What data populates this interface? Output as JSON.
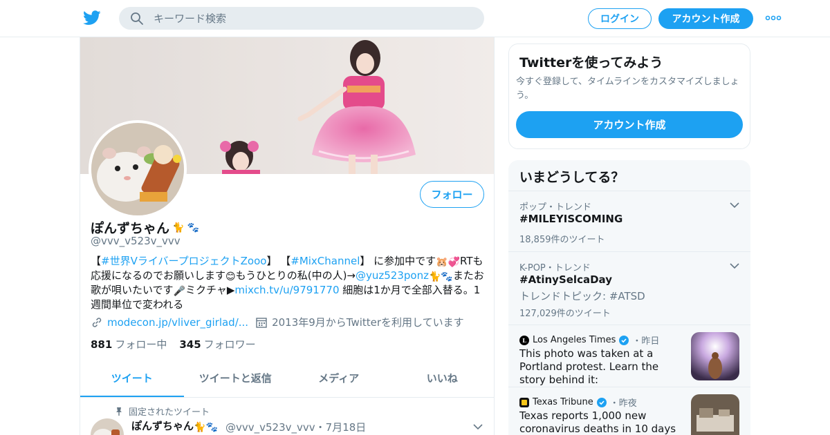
{
  "header": {
    "search_placeholder": "キーワード検索",
    "login_label": "ログイン",
    "signup_label": "アカウント作成"
  },
  "profile": {
    "display_name": "ぽんずちゃん",
    "name_emojis": [
      "🐈",
      "🐾"
    ],
    "handle": "@vvv_v523v_vvv",
    "follow_label": "フォロー",
    "bio": {
      "part1": "【",
      "link1": "#世界Vライバープロジェクト",
      "link1b": "Zooo",
      "part2": "】 【",
      "link2": "#MixChannel",
      "part3": "】 に参加中です",
      "emoji1": "🐹💞",
      "part4": "RTも応援になるのでお願いします",
      "emoji2": "😊",
      "part5": "もうひとりの私(中の人)→",
      "link3": "@yuz523ponz",
      "emoji3": "🐈🐾",
      "part6": "またお歌が唄いたいです",
      "emoji4": "🎤",
      "part7": "ミクチャ▶",
      "link4": "mixch.tv/u/9791770",
      "part8": " 細胞は1か月で全部入替る。1週間単位で変われる"
    },
    "website": "modecon.jp/vliver_girlad/...",
    "joined": "2013年9月からTwitterを利用しています",
    "following_count": "881",
    "following_label": "フォロー中",
    "followers_count": "345",
    "followers_label": "フォロワー"
  },
  "tabs": [
    "ツイート",
    "ツイートと返信",
    "メディア",
    "いいね"
  ],
  "pinned_tweet": {
    "pinned_label": "固定されたツイート",
    "author": "ぽんずちゃん",
    "author_emojis": "🐈🐾",
    "handle_date": "@vvv_v523v_vvv・7月18日"
  },
  "signup_card": {
    "title": "Twitterを使ってみよう",
    "description": "今すぐ登録して、タイムラインをカスタマイズしましょう。",
    "button": "アカウント作成"
  },
  "trends": {
    "title": "いまどうしてる？",
    "items": [
      {
        "context": "ポップ・トレンド",
        "name": "#MILEYISCOMING",
        "count": "18,859件のツイート"
      },
      {
        "context": "K-POP・トレンド",
        "name": "#AtinySelcaDay",
        "subtopic": "トレンドトピック: #ATSD",
        "count": "127,029件のツイート"
      }
    ],
    "news": [
      {
        "source": "Los Angeles Times",
        "when": "・昨日",
        "headline": "This photo was taken at a Portland protest. Learn the story behind it:"
      },
      {
        "source": "Texas Tribune",
        "when": "・昨夜",
        "headline": "Texas reports 1,000 new coronavirus deaths in 10 days"
      }
    ]
  },
  "colors": {
    "accent": "#1da1f2",
    "text": "#14171a",
    "muted": "#657786",
    "border": "#e6ecf0"
  }
}
